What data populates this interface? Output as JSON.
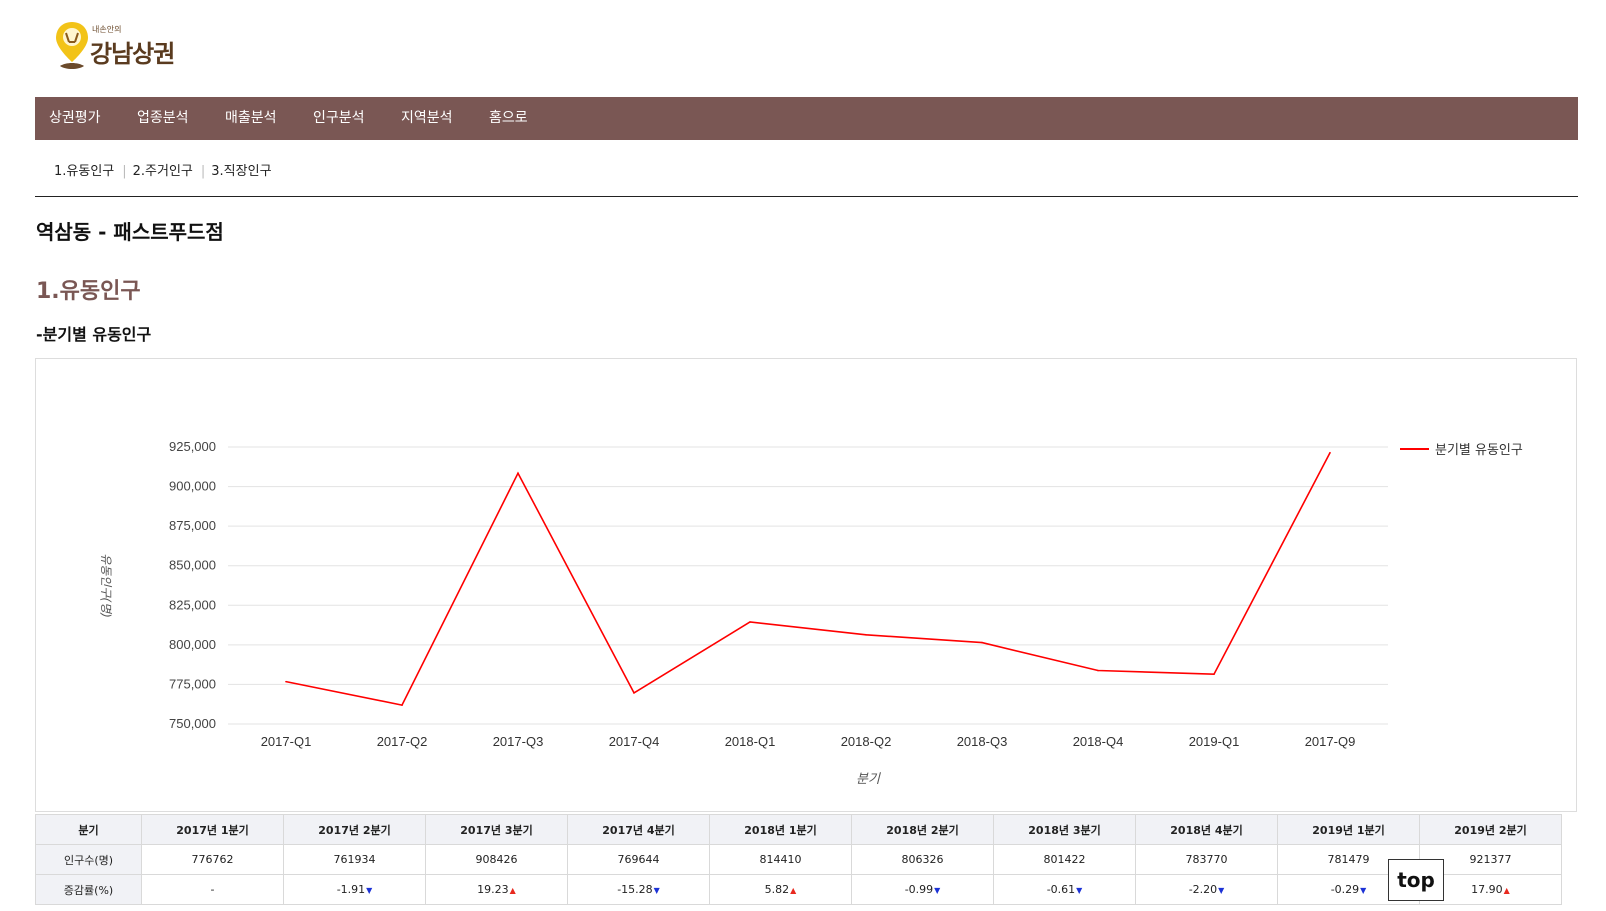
{
  "logo": {
    "small_text": "내손안의",
    "main_text": "강남상권"
  },
  "nav": {
    "items": [
      {
        "label": "상권평가"
      },
      {
        "label": "업종분석"
      },
      {
        "label": "매출분석"
      },
      {
        "label": "인구분석"
      },
      {
        "label": "지역분석"
      },
      {
        "label": "홈으로"
      }
    ]
  },
  "subnav": {
    "items": [
      {
        "label": "1.유동인구"
      },
      {
        "label": "2.주거인구"
      },
      {
        "label": "3.직장인구"
      }
    ]
  },
  "page_title": "역삼동 - 패스트푸드점",
  "section_title": "1.유동인구",
  "sub_title": "-분기별 유동인구",
  "colors": {
    "nav_bg": "#7a5754",
    "line": "#ff0000",
    "up": "#e8291f",
    "down": "#1c32d6"
  },
  "chart_data": {
    "type": "line",
    "categories": [
      "2017-Q1",
      "2017-Q2",
      "2017-Q3",
      "2017-Q4",
      "2018-Q1",
      "2018-Q2",
      "2018-Q3",
      "2018-Q4",
      "2019-Q1",
      "2017-Q9"
    ],
    "series": [
      {
        "name": "분기별 유동인구",
        "values": [
          776762,
          761934,
          908426,
          769644,
          814410,
          806326,
          801422,
          783770,
          781479,
          921377
        ]
      }
    ],
    "ylim": [
      750000,
      925000
    ],
    "yticks": [
      750000,
      775000,
      800000,
      825000,
      850000,
      875000,
      900000,
      925000
    ],
    "xlabel": "분기",
    "ylabel": "유동인구(명)",
    "grid": true,
    "legend_position": "top-right"
  },
  "table": {
    "headers": [
      "분기",
      "2017년 1분기",
      "2017년 2분기",
      "2017년 3분기",
      "2017년 4분기",
      "2018년 1분기",
      "2018년 2분기",
      "2018년 3분기",
      "2018년 4분기",
      "2019년 1분기",
      "2019년 2분기"
    ],
    "rows": [
      {
        "label": "인구수(명)",
        "cells": [
          {
            "text": "776762",
            "dir": ""
          },
          {
            "text": "761934",
            "dir": ""
          },
          {
            "text": "908426",
            "dir": ""
          },
          {
            "text": "769644",
            "dir": ""
          },
          {
            "text": "814410",
            "dir": ""
          },
          {
            "text": "806326",
            "dir": ""
          },
          {
            "text": "801422",
            "dir": ""
          },
          {
            "text": "783770",
            "dir": ""
          },
          {
            "text": "781479",
            "dir": ""
          },
          {
            "text": "921377",
            "dir": ""
          }
        ]
      },
      {
        "label": "증감률(%)",
        "cells": [
          {
            "text": "-",
            "dir": ""
          },
          {
            "text": "-1.91",
            "dir": "down"
          },
          {
            "text": "19.23",
            "dir": "up"
          },
          {
            "text": "-15.28",
            "dir": "down"
          },
          {
            "text": "5.82",
            "dir": "up"
          },
          {
            "text": "-0.99",
            "dir": "down"
          },
          {
            "text": "-0.61",
            "dir": "down"
          },
          {
            "text": "-2.20",
            "dir": "down"
          },
          {
            "text": "-0.29",
            "dir": "down"
          },
          {
            "text": "17.90",
            "dir": "up"
          }
        ]
      }
    ]
  },
  "top_button": {
    "label": "top"
  }
}
